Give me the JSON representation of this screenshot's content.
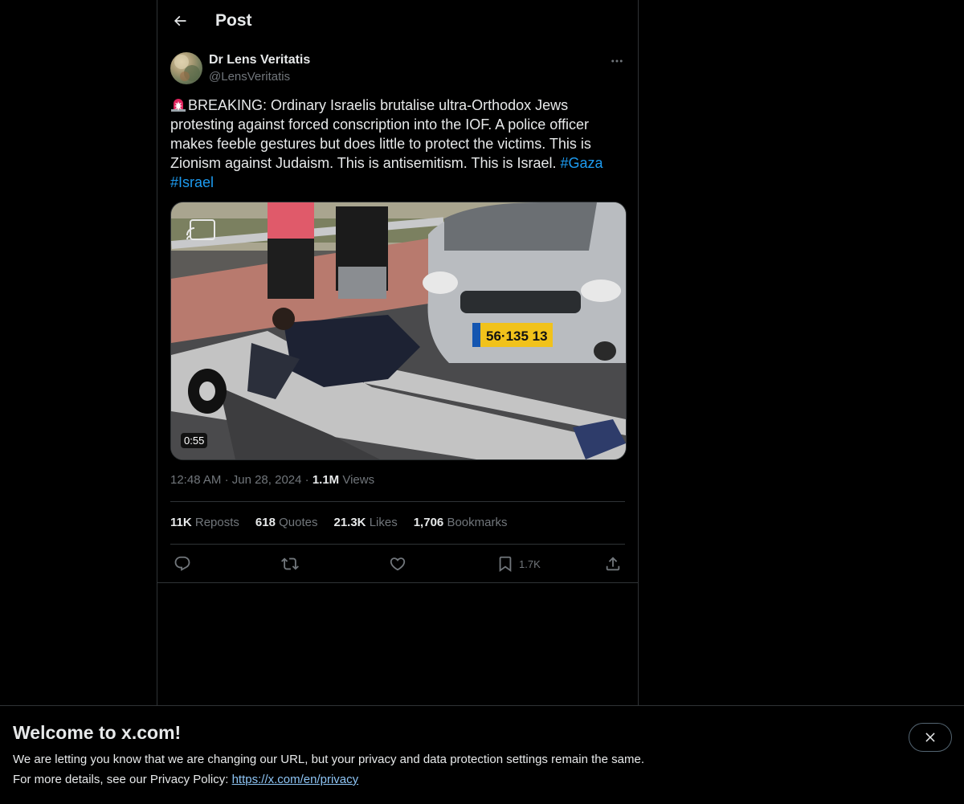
{
  "header": {
    "title": "Post",
    "back_icon": "arrow-left-icon"
  },
  "author": {
    "name": "Dr Lens Veritatis",
    "handle": "@LensVeritatis"
  },
  "tweet": {
    "emoji": "🚨",
    "text": "BREAKING: Ordinary Israelis brutalise ultra-Orthodox Jews protesting against forced conscription into the IOF. A police officer makes feeble gestures but does little to protect the victims. This is Zionism against Judaism. This is antisemitism. This is Israel.",
    "hashtags": [
      "#Gaza",
      "#Israel"
    ]
  },
  "media": {
    "duration": "0:55",
    "plate": "56·135 13",
    "cast_icon": "cast-icon"
  },
  "meta": {
    "time": "12:48 AM",
    "separator": "·",
    "date": "Jun 28, 2024",
    "views_count": "1.1M",
    "views_label": "Views"
  },
  "stats": [
    {
      "count": "11K",
      "label": "Reposts"
    },
    {
      "count": "618",
      "label": "Quotes"
    },
    {
      "count": "21.3K",
      "label": "Likes"
    },
    {
      "count": "1,706",
      "label": "Bookmarks"
    }
  ],
  "actions": {
    "reply_icon": "reply-icon",
    "repost_icon": "repost-icon",
    "like_icon": "heart-icon",
    "bookmark_icon": "bookmark-icon",
    "bookmark_count": "1.7K",
    "share_icon": "share-icon"
  },
  "banner": {
    "title": "Welcome to x.com!",
    "line1": "We are letting you know that we are changing our URL, but your privacy and data protection settings remain the same.",
    "line2_prefix": "For more details, see our Privacy Policy: ",
    "link": "https://x.com/en/privacy"
  },
  "colors": {
    "accent": "#1d9bf0",
    "muted": "#71767b",
    "text": "#e7e9ea",
    "border": "#2f3336"
  }
}
